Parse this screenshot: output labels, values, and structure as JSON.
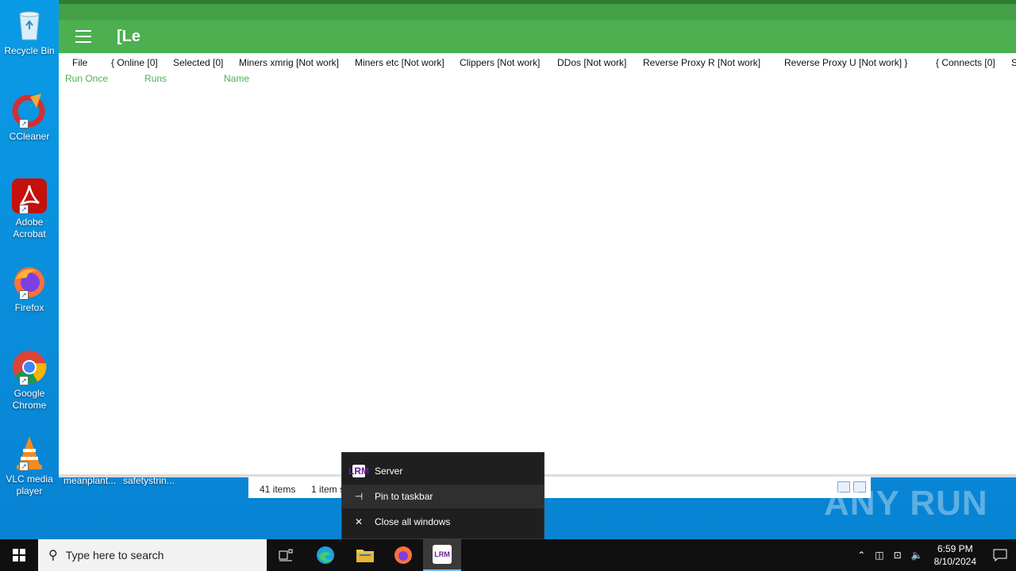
{
  "desktop": {
    "icons": [
      {
        "label": "Recycle Bin"
      },
      {
        "label": "CCleaner"
      },
      {
        "label": "Adobe Acrobat"
      },
      {
        "label": "Firefox"
      },
      {
        "label": "Google Chrome"
      },
      {
        "label": "VLC media player"
      }
    ],
    "files": [
      "meanplant...",
      "safetystrin..."
    ]
  },
  "app": {
    "logo": "[Le",
    "menu": [
      "File",
      "{ Online [0]",
      "Selected [0]",
      "Miners xmrig [Not work]",
      "Miners etc [Not work]",
      "Clippers [Not work]",
      "DDos [Not work]",
      "Reverse Proxy R [Not work]",
      "Reverse Proxy U [Not work] }",
      "{ Connects [0]",
      "S"
    ],
    "subtabs": [
      "Run Once",
      "Runs",
      "Name"
    ],
    "accent_color": "#4caf50"
  },
  "explorer": {
    "item_count": "41 items",
    "selected": "1 item s"
  },
  "context_menu": {
    "items": [
      {
        "label": "Server",
        "icon": "lrm-app-icon"
      },
      {
        "label": "Pin to taskbar",
        "icon": "pin-icon"
      },
      {
        "label": "Close all windows",
        "icon": "close-icon"
      }
    ]
  },
  "watermark": "ANY RUN",
  "taskbar": {
    "search_placeholder": "Type here to search",
    "time": "6:59 PM",
    "date": "8/10/2024"
  }
}
